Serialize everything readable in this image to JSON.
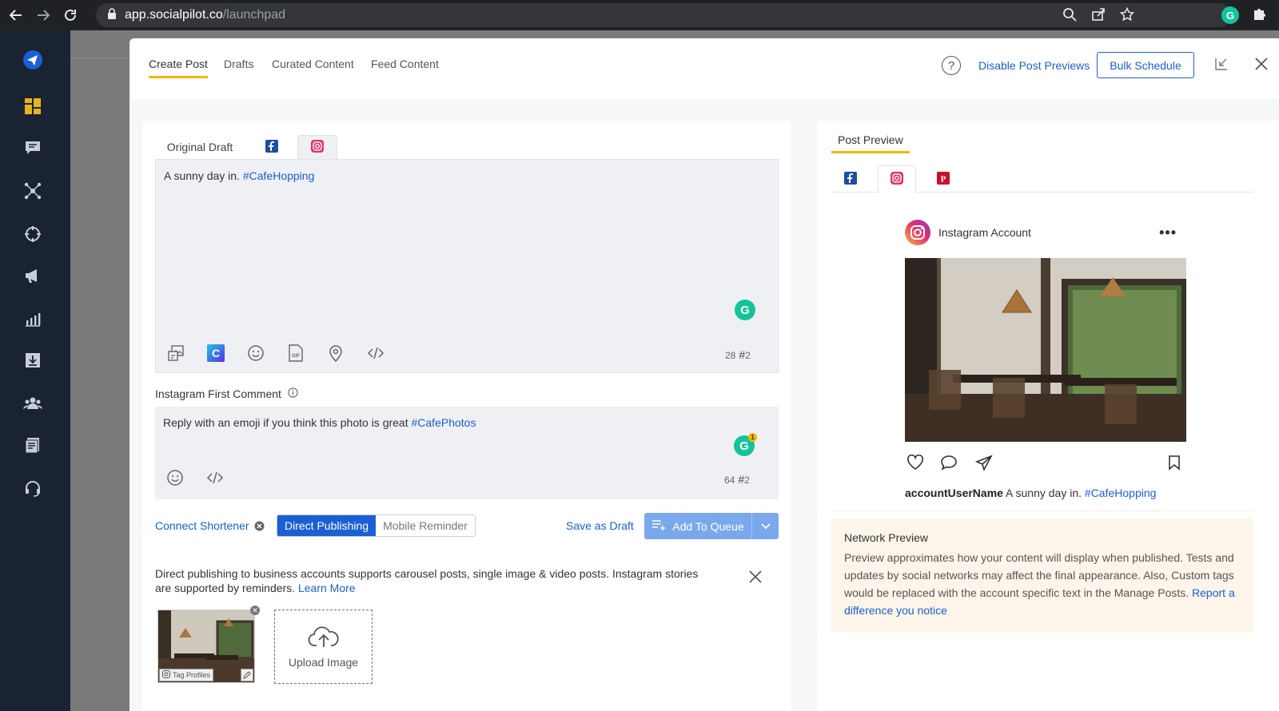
{
  "browser": {
    "url_host": "app.socialpilot.co",
    "url_path": "/launchpad"
  },
  "header": {
    "tabs": [
      "Create Post",
      "Drafts",
      "Curated Content",
      "Feed Content"
    ],
    "disable_previews": "Disable Post Previews",
    "bulk_schedule": "Bulk Schedule"
  },
  "editor": {
    "tab_original": "Original Draft",
    "post_text": "A sunny day in. ",
    "post_hashtag": "#CafeHopping",
    "char_count": "28",
    "hashtag_count": "2",
    "first_comment_label": "Instagram First Comment",
    "comment_text": "Reply with an emoji if you think this photo is great ",
    "comment_hashtag": "#CafePhotos",
    "comment_char_count": "64",
    "comment_hashtag_count": "2",
    "grammarly_badge": "1"
  },
  "actions": {
    "connect_shortener": "Connect Shortener",
    "direct_publishing": "Direct Publishing",
    "mobile_reminder": "Mobile Reminder",
    "save_draft": "Save as Draft",
    "add_queue": "Add To Queue"
  },
  "info": {
    "text": "Direct publishing to business accounts supports carousel posts, single image & video posts. Instagram stories are supported by reminders. ",
    "learn_more": "Learn More"
  },
  "media": {
    "tag_profiles": "Tag Profiles",
    "upload_label": "Upload Image"
  },
  "preview": {
    "title": "Post Preview",
    "account_name": "Instagram Account",
    "username": "accountUserName",
    "caption": " A sunny day in. ",
    "caption_hashtag": "#CafeHopping",
    "network_title": "Network Preview",
    "network_text": "Preview approximates how your content will display when published. Tests and updates by social networks may affect the final appearance. Also, Custom tags would be replaced with the account specific text in the Manage Posts. ",
    "report_link": "Report a difference you notice"
  },
  "colors": {
    "accent_blue": "#1a5fd6",
    "tab_underline": "#f5b700",
    "sidebar_bg": "#1a2332",
    "grammarly": "#15c39a"
  }
}
